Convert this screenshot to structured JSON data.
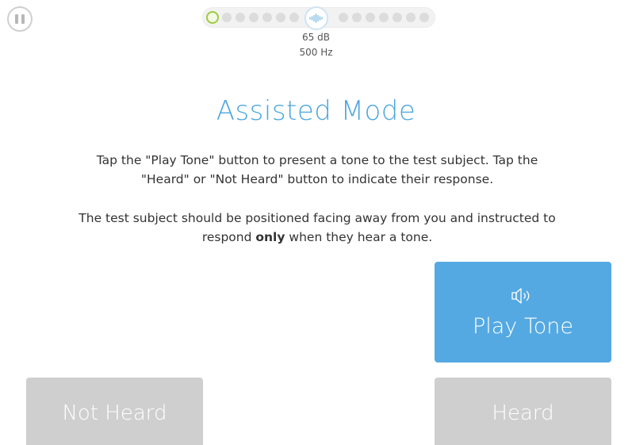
{
  "progress": {
    "current_index": 0,
    "left_dots": 7,
    "right_dots": 7,
    "level_db": "65 dB",
    "frequency": "500 Hz",
    "center_icon": "waveform-icon",
    "current_color": "#9ccc3c"
  },
  "header": {
    "pause_icon": "pause-icon"
  },
  "main": {
    "title": "Assisted Mode",
    "instruction_1": "Tap the \"Play Tone\" button to present a tone to the test subject. Tap the \"Heard\" or \"Not Heard\" button to indicate their response.",
    "instruction_2_prefix": "The test subject should be positioned facing away from you and instructed to respond ",
    "instruction_2_bold": "only",
    "instruction_2_suffix": " when they hear a tone."
  },
  "buttons": {
    "play_tone": "Play Tone",
    "play_icon": "speaker-icon",
    "not_heard": "Not Heard",
    "heard": "Heard"
  },
  "colors": {
    "accent": "#55a9e2",
    "title": "#4da6dc",
    "disabled": "#cfcfcf"
  }
}
